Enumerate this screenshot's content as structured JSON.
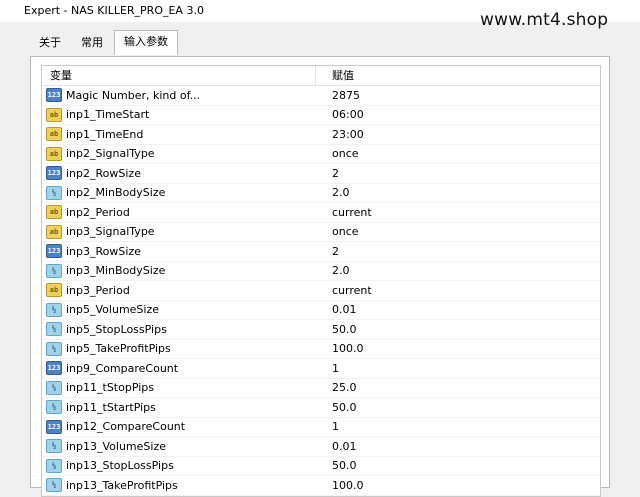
{
  "window": {
    "title": "Expert - NAS KILLER_PRO_EA 3.0",
    "watermark": "www.mt4.shop"
  },
  "tabs": [
    {
      "label": "关于"
    },
    {
      "label": "常用"
    },
    {
      "label": "输入参数",
      "active": true
    }
  ],
  "table": {
    "headers": [
      "变量",
      "赋值"
    ],
    "rows": [
      {
        "type": "int",
        "icon_text": "123",
        "name": "Magic Number, kind of...",
        "value": "2875"
      },
      {
        "type": "str",
        "icon_text": "ab",
        "name": "inp1_TimeStart",
        "value": "06:00"
      },
      {
        "type": "str",
        "icon_text": "ab",
        "name": "inp1_TimeEnd",
        "value": "23:00"
      },
      {
        "type": "str",
        "icon_text": "ab",
        "name": "inp2_SignalType",
        "value": "once"
      },
      {
        "type": "int",
        "icon_text": "123",
        "name": "inp2_RowSize",
        "value": "2"
      },
      {
        "type": "dbl",
        "icon_text": "½",
        "name": "inp2_MinBodySize",
        "value": "2.0"
      },
      {
        "type": "str",
        "icon_text": "ab",
        "name": "inp2_Period",
        "value": "current"
      },
      {
        "type": "str",
        "icon_text": "ab",
        "name": "inp3_SignalType",
        "value": "once"
      },
      {
        "type": "int",
        "icon_text": "123",
        "name": "inp3_RowSize",
        "value": "2"
      },
      {
        "type": "dbl",
        "icon_text": "½",
        "name": "inp3_MinBodySize",
        "value": "2.0"
      },
      {
        "type": "str",
        "icon_text": "ab",
        "name": "inp3_Period",
        "value": "current"
      },
      {
        "type": "dbl",
        "icon_text": "½",
        "name": "inp5_VolumeSize",
        "value": "0.01"
      },
      {
        "type": "dbl",
        "icon_text": "½",
        "name": "inp5_StopLossPips",
        "value": "50.0"
      },
      {
        "type": "dbl",
        "icon_text": "½",
        "name": "inp5_TakeProfitPips",
        "value": "100.0"
      },
      {
        "type": "int",
        "icon_text": "123",
        "name": "inp9_CompareCount",
        "value": "1"
      },
      {
        "type": "dbl",
        "icon_text": "½",
        "name": "inp11_tStopPips",
        "value": "25.0"
      },
      {
        "type": "dbl",
        "icon_text": "½",
        "name": "inp11_tStartPips",
        "value": "50.0"
      },
      {
        "type": "int",
        "icon_text": "123",
        "name": "inp12_CompareCount",
        "value": "1"
      },
      {
        "type": "dbl",
        "icon_text": "½",
        "name": "inp13_VolumeSize",
        "value": "0.01"
      },
      {
        "type": "dbl",
        "icon_text": "½",
        "name": "inp13_StopLossPips",
        "value": "50.0"
      },
      {
        "type": "dbl",
        "icon_text": "½",
        "name": "inp13_TakeProfitPips",
        "value": "100.0"
      }
    ]
  }
}
